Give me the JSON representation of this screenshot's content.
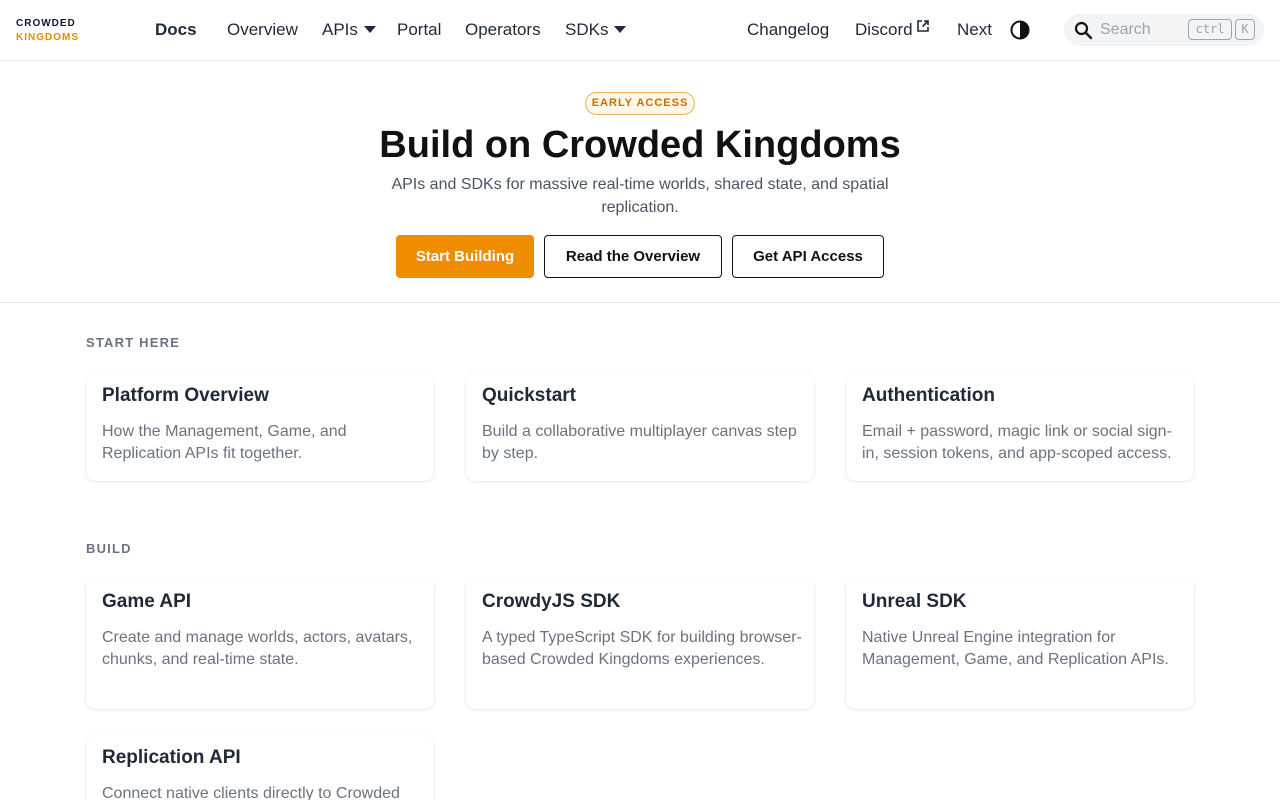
{
  "logo": {
    "line1": "CROWDED",
    "line2": "KINGDOMS"
  },
  "nav": {
    "docs": "Docs",
    "overview": "Overview",
    "apis": "APIs",
    "portal": "Portal",
    "operators": "Operators",
    "sdks": "SDKs",
    "changelog": "Changelog",
    "discord": "Discord",
    "next": "Next"
  },
  "search": {
    "placeholder": "Search",
    "key1": "ctrl",
    "key2": "K"
  },
  "hero": {
    "badge": "EARLY ACCESS",
    "title": "Build on Crowded Kingdoms",
    "subtitle": "APIs and SDKs for massive real-time worlds, shared state, and spatial replication.",
    "primary_button": "Start Building",
    "overview_button": "Read the Overview",
    "access_button": "Get API Access"
  },
  "sections": {
    "start_here": {
      "label": "START HERE",
      "cards": [
        {
          "title": "Platform Overview",
          "desc": "How the Management, Game, and Replication APIs fit together."
        },
        {
          "title": "Quickstart",
          "desc": "Build a collaborative multiplayer canvas step by step."
        },
        {
          "title": "Authentication",
          "desc": "Email + password, magic link or social sign-in, session tokens, and app-scoped access."
        }
      ]
    },
    "build": {
      "label": "BUILD",
      "cards": [
        {
          "title": "Game API",
          "desc": "Create and manage worlds, actors, avatars, chunks, and real-time state."
        },
        {
          "title": "CrowdyJS SDK",
          "desc": "A typed TypeScript SDK for building browser-based Crowded Kingdoms experiences."
        },
        {
          "title": "Unreal SDK",
          "desc": "Native Unreal Engine integration for Management, Game, and Replication APIs."
        },
        {
          "title": "Replication API",
          "desc": "Connect native clients directly to Crowded"
        }
      ]
    }
  },
  "colors": {
    "accent": "#f08c00",
    "logo_accent": "#e88a00",
    "muted_text": "#6b7280"
  }
}
